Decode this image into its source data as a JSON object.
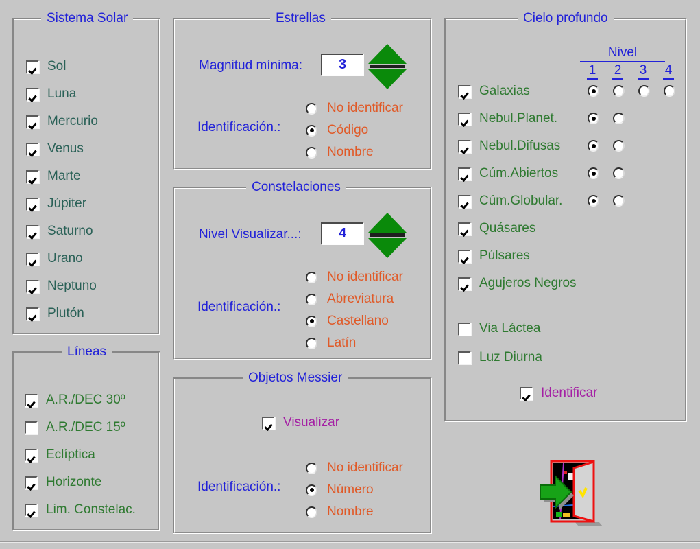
{
  "groups": {
    "solar": {
      "title": "Sistema Solar",
      "items": [
        {
          "label": "Sol",
          "checked": true
        },
        {
          "label": "Luna",
          "checked": true
        },
        {
          "label": "Mercurio",
          "checked": true
        },
        {
          "label": "Venus",
          "checked": true
        },
        {
          "label": "Marte",
          "checked": true
        },
        {
          "label": "Júpiter",
          "checked": true
        },
        {
          "label": "Saturno",
          "checked": true
        },
        {
          "label": "Urano",
          "checked": true
        },
        {
          "label": "Neptuno",
          "checked": true
        },
        {
          "label": "Plutón",
          "checked": true
        }
      ]
    },
    "lineas": {
      "title": "Líneas",
      "items": [
        {
          "label": "A.R./DEC 30º",
          "checked": true
        },
        {
          "label": "A.R./DEC 15º",
          "checked": false
        },
        {
          "label": "Eclíptica",
          "checked": true
        },
        {
          "label": "Horizonte",
          "checked": true
        },
        {
          "label": "Lim. Constelac.",
          "checked": true
        }
      ]
    },
    "estrellas": {
      "title": "Estrellas",
      "magnitude_label": "Magnitud mínima:",
      "magnitude_value": "3",
      "spinner_name": "magnitude-spinner",
      "ident_label": "Identificación.:",
      "ident_options": [
        {
          "label": "No identificar",
          "selected": false
        },
        {
          "label": "Código",
          "selected": true
        },
        {
          "label": "Nombre",
          "selected": false
        }
      ]
    },
    "constelaciones": {
      "title": "Constelaciones",
      "nivel_label": "Nivel Visualizar...:",
      "nivel_value": "4",
      "spinner_name": "nivel-spinner",
      "ident_label": "Identificación.:",
      "ident_options": [
        {
          "label": "No identificar",
          "selected": false
        },
        {
          "label": "Abreviatura",
          "selected": false
        },
        {
          "label": "Castellano",
          "selected": true
        },
        {
          "label": "Latín",
          "selected": false
        }
      ]
    },
    "messier": {
      "title": "Objetos Messier",
      "visualizar_label": "Visualizar",
      "visualizar_checked": true,
      "ident_label": "Identificación.:",
      "ident_options": [
        {
          "label": "No identificar",
          "selected": false
        },
        {
          "label": "Número",
          "selected": true
        },
        {
          "label": "Nombre",
          "selected": false
        }
      ]
    },
    "cielo": {
      "title": "Cielo profundo",
      "nivel_header": "Nivel",
      "nivel_columns": [
        "1",
        "2",
        "3",
        "4"
      ],
      "items": [
        {
          "label": "Galaxias",
          "checked": true,
          "radios": 4,
          "selected": 1
        },
        {
          "label": "Nebul.Planet.",
          "checked": true,
          "radios": 2,
          "selected": 1
        },
        {
          "label": "Nebul.Difusas",
          "checked": true,
          "radios": 2,
          "selected": 1
        },
        {
          "label": "Cúm.Abiertos",
          "checked": true,
          "radios": 2,
          "selected": 1
        },
        {
          "label": "Cúm.Globular.",
          "checked": true,
          "radios": 2,
          "selected": 1
        },
        {
          "label": "Quásares",
          "checked": true,
          "radios": 0,
          "selected": 0
        },
        {
          "label": "Púlsares",
          "checked": true,
          "radios": 0,
          "selected": 0
        },
        {
          "label": "Agujeros Negros",
          "checked": true,
          "radios": 0,
          "selected": 0
        }
      ],
      "extras": [
        {
          "label": "Via Láctea",
          "checked": false
        },
        {
          "label": "Luz Diurna",
          "checked": false
        }
      ],
      "identificar_label": "Identificar",
      "identificar_checked": true
    }
  },
  "exit_button": {
    "name": "exit-icon",
    "tooltip": ""
  },
  "colors": {
    "background": "#c6c6c6",
    "title_blue": "#2222d8",
    "solar_label": "#2a6157",
    "green_label": "#2f7a31",
    "orange_label": "#e05a28",
    "purple_label": "#a41fa4",
    "spinner_green": "#0a8a0a",
    "door_red": "#ee1111"
  }
}
